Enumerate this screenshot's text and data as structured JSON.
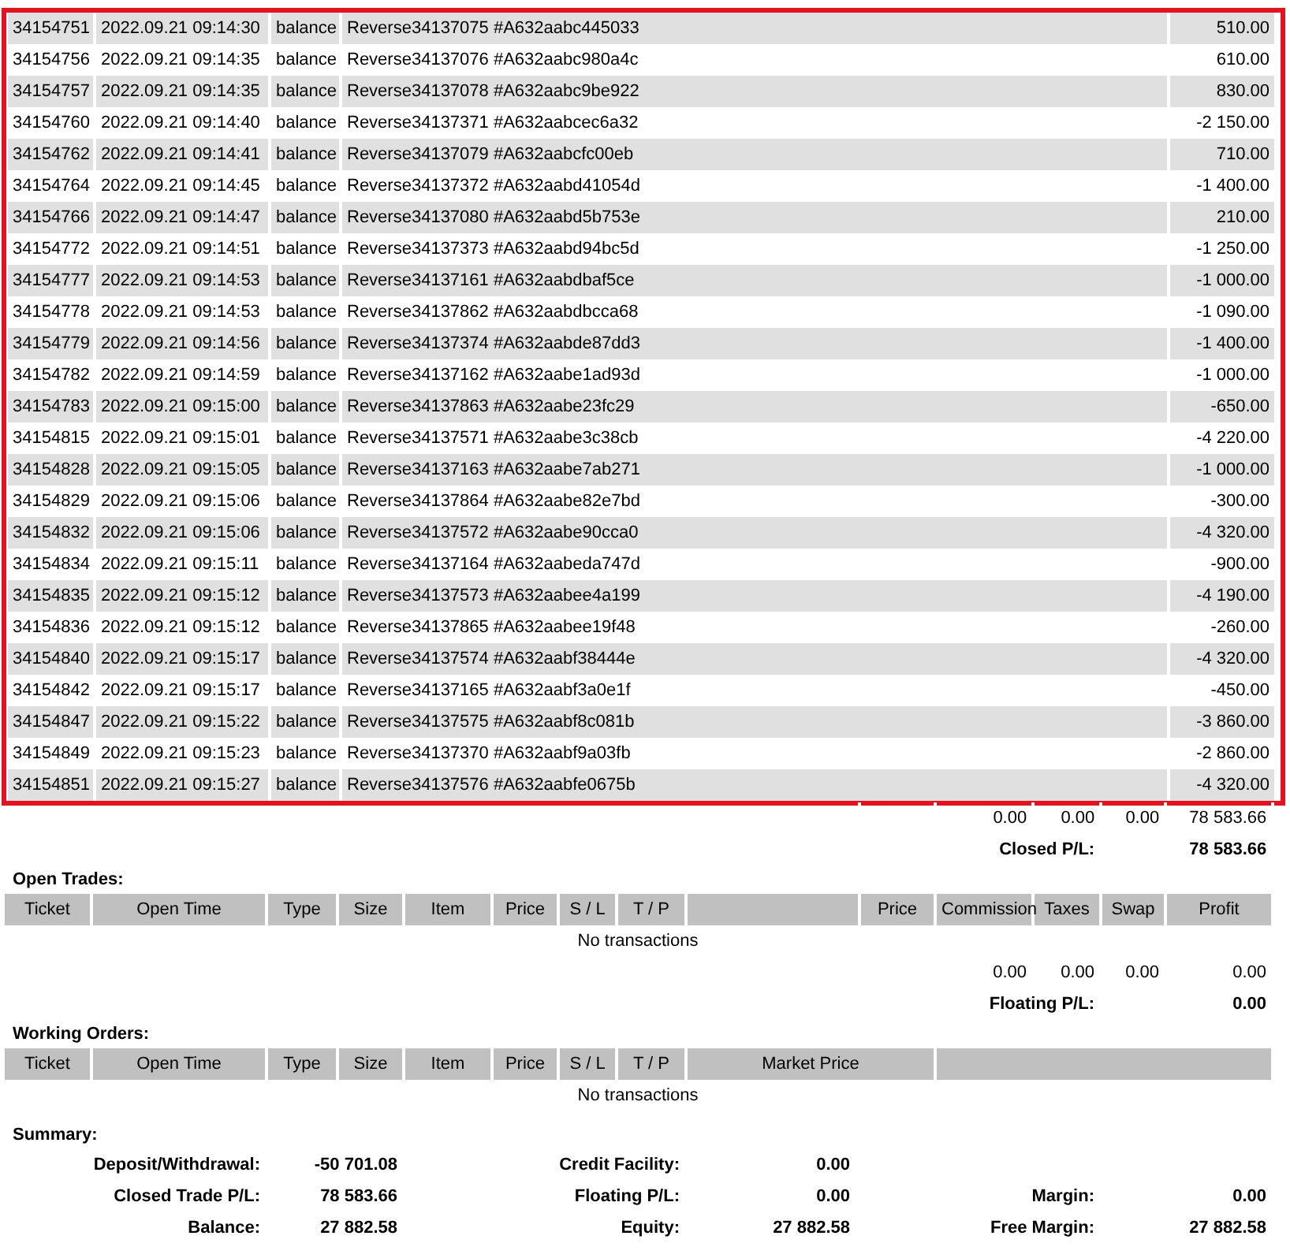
{
  "closed_transactions": {
    "highlighted": true,
    "rows": [
      {
        "ticket": "34154751",
        "time": "2022.09.21 09:14:30",
        "type": "balance",
        "comment": "Reverse34137075 #A632aabc445033",
        "profit": "510.00"
      },
      {
        "ticket": "34154756",
        "time": "2022.09.21 09:14:35",
        "type": "balance",
        "comment": "Reverse34137076 #A632aabc980a4c",
        "profit": "610.00"
      },
      {
        "ticket": "34154757",
        "time": "2022.09.21 09:14:35",
        "type": "balance",
        "comment": "Reverse34137078 #A632aabc9be922",
        "profit": "830.00"
      },
      {
        "ticket": "34154760",
        "time": "2022.09.21 09:14:40",
        "type": "balance",
        "comment": "Reverse34137371 #A632aabcec6a32",
        "profit": "-2 150.00"
      },
      {
        "ticket": "34154762",
        "time": "2022.09.21 09:14:41",
        "type": "balance",
        "comment": "Reverse34137079 #A632aabcfc00eb",
        "profit": "710.00"
      },
      {
        "ticket": "34154764",
        "time": "2022.09.21 09:14:45",
        "type": "balance",
        "comment": "Reverse34137372 #A632aabd41054d",
        "profit": "-1 400.00"
      },
      {
        "ticket": "34154766",
        "time": "2022.09.21 09:14:47",
        "type": "balance",
        "comment": "Reverse34137080 #A632aabd5b753e",
        "profit": "210.00"
      },
      {
        "ticket": "34154772",
        "time": "2022.09.21 09:14:51",
        "type": "balance",
        "comment": "Reverse34137373 #A632aabd94bc5d",
        "profit": "-1 250.00"
      },
      {
        "ticket": "34154777",
        "time": "2022.09.21 09:14:53",
        "type": "balance",
        "comment": "Reverse34137161 #A632aabdbaf5ce",
        "profit": "-1 000.00"
      },
      {
        "ticket": "34154778",
        "time": "2022.09.21 09:14:53",
        "type": "balance",
        "comment": "Reverse34137862 #A632aabdbcca68",
        "profit": "-1 090.00"
      },
      {
        "ticket": "34154779",
        "time": "2022.09.21 09:14:56",
        "type": "balance",
        "comment": "Reverse34137374 #A632aabde87dd3",
        "profit": "-1 400.00"
      },
      {
        "ticket": "34154782",
        "time": "2022.09.21 09:14:59",
        "type": "balance",
        "comment": "Reverse34137162 #A632aabe1ad93d",
        "profit": "-1 000.00"
      },
      {
        "ticket": "34154783",
        "time": "2022.09.21 09:15:00",
        "type": "balance",
        "comment": "Reverse34137863 #A632aabe23fc29",
        "profit": "-650.00"
      },
      {
        "ticket": "34154815",
        "time": "2022.09.21 09:15:01",
        "type": "balance",
        "comment": "Reverse34137571 #A632aabe3c38cb",
        "profit": "-4 220.00"
      },
      {
        "ticket": "34154828",
        "time": "2022.09.21 09:15:05",
        "type": "balance",
        "comment": "Reverse34137163 #A632aabe7ab271",
        "profit": "-1 000.00"
      },
      {
        "ticket": "34154829",
        "time": "2022.09.21 09:15:06",
        "type": "balance",
        "comment": "Reverse34137864 #A632aabe82e7bd",
        "profit": "-300.00"
      },
      {
        "ticket": "34154832",
        "time": "2022.09.21 09:15:06",
        "type": "balance",
        "comment": "Reverse34137572 #A632aabe90cca0",
        "profit": "-4 320.00"
      },
      {
        "ticket": "34154834",
        "time": "2022.09.21 09:15:11",
        "type": "balance",
        "comment": "Reverse34137164 #A632aabeda747d",
        "profit": "-900.00"
      },
      {
        "ticket": "34154835",
        "time": "2022.09.21 09:15:12",
        "type": "balance",
        "comment": "Reverse34137573 #A632aabee4a199",
        "profit": "-4 190.00"
      },
      {
        "ticket": "34154836",
        "time": "2022.09.21 09:15:12",
        "type": "balance",
        "comment": "Reverse34137865 #A632aabee19f48",
        "profit": "-260.00"
      },
      {
        "ticket": "34154840",
        "time": "2022.09.21 09:15:17",
        "type": "balance",
        "comment": "Reverse34137574 #A632aabf38444e",
        "profit": "-4 320.00"
      },
      {
        "ticket": "34154842",
        "time": "2022.09.21 09:15:17",
        "type": "balance",
        "comment": "Reverse34137165 #A632aabf3a0e1f",
        "profit": "-450.00"
      },
      {
        "ticket": "34154847",
        "time": "2022.09.21 09:15:22",
        "type": "balance",
        "comment": "Reverse34137575 #A632aabf8c081b",
        "profit": "-3 860.00"
      },
      {
        "ticket": "34154849",
        "time": "2022.09.21 09:15:23",
        "type": "balance",
        "comment": "Reverse34137370 #A632aabf9a03fb",
        "profit": "-2 860.00"
      },
      {
        "ticket": "34154851",
        "time": "2022.09.21 09:15:27",
        "type": "balance",
        "comment": "Reverse34137576 #A632aabfe0675b",
        "profit": "-4 320.00"
      }
    ],
    "totals": {
      "commission": "0.00",
      "taxes": "0.00",
      "swap": "0.00",
      "profit": "78 583.66"
    },
    "closed_pl": {
      "label": "Closed P/L:",
      "value": "78 583.66"
    }
  },
  "open_trades": {
    "title": "Open Trades:",
    "columns": [
      "Ticket",
      "Open Time",
      "Type",
      "Size",
      "Item",
      "Price",
      "S / L",
      "T / P",
      "Price",
      "Commission",
      "Taxes",
      "Swap",
      "Profit"
    ],
    "empty_message": "No transactions",
    "totals": {
      "commission": "0.00",
      "taxes": "0.00",
      "swap": "0.00",
      "profit": "0.00"
    },
    "floating_pl": {
      "label": "Floating P/L:",
      "value": "0.00"
    }
  },
  "working_orders": {
    "title": "Working Orders:",
    "columns": [
      "Ticket",
      "Open Time",
      "Type",
      "Size",
      "Item",
      "Price",
      "S / L",
      "T / P",
      "Market Price"
    ],
    "empty_message": "No transactions"
  },
  "summary": {
    "title": "Summary:",
    "rows": [
      [
        {
          "label": "Deposit/Withdrawal:",
          "value": "-50 701.08"
        },
        {
          "label": "Credit Facility:",
          "value": "0.00"
        }
      ],
      [
        {
          "label": "Closed Trade P/L:",
          "value": "78 583.66"
        },
        {
          "label": "Floating P/L:",
          "value": "0.00"
        },
        {
          "label": "Margin:",
          "value": "0.00"
        }
      ],
      [
        {
          "label": "Balance:",
          "value": "27 882.58"
        },
        {
          "label": "Equity:",
          "value": "27 882.58"
        },
        {
          "label": "Free Margin:",
          "value": "27 882.58"
        }
      ]
    ]
  }
}
